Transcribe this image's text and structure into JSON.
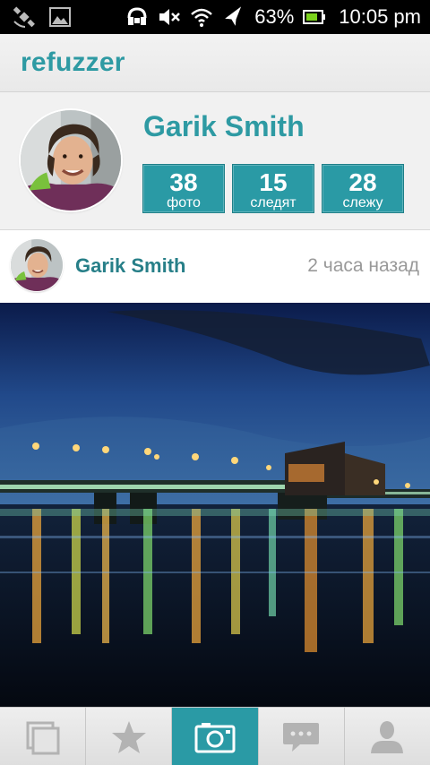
{
  "status_bar": {
    "battery_percent": "63%",
    "time": "10:05 pm",
    "left_icons": [
      "satellite-icon",
      "image-icon"
    ],
    "right_icons": [
      "headset-icon",
      "mute-icon",
      "wifi-icon",
      "airplane-icon",
      "battery-icon"
    ]
  },
  "app_bar": {
    "title": "refuzzer"
  },
  "profile": {
    "name": "Garik Smith",
    "stats": [
      {
        "value": "38",
        "label": "фото"
      },
      {
        "value": "15",
        "label": "следят"
      },
      {
        "value": "28",
        "label": "слежу"
      }
    ]
  },
  "post": {
    "author": "Garik Smith",
    "time": "2 часа назад"
  },
  "tabs": [
    {
      "name": "feed",
      "icon": "gallery-icon",
      "active": false
    },
    {
      "name": "favorites",
      "icon": "star-icon",
      "active": false
    },
    {
      "name": "camera",
      "icon": "camera-icon",
      "active": true
    },
    {
      "name": "messages",
      "icon": "chat-icon",
      "active": false
    },
    {
      "name": "profile",
      "icon": "user-icon",
      "active": false
    }
  ],
  "colors": {
    "accent": "#2e9aa3",
    "status_bar": "#000000",
    "muted_text": "#999999"
  }
}
